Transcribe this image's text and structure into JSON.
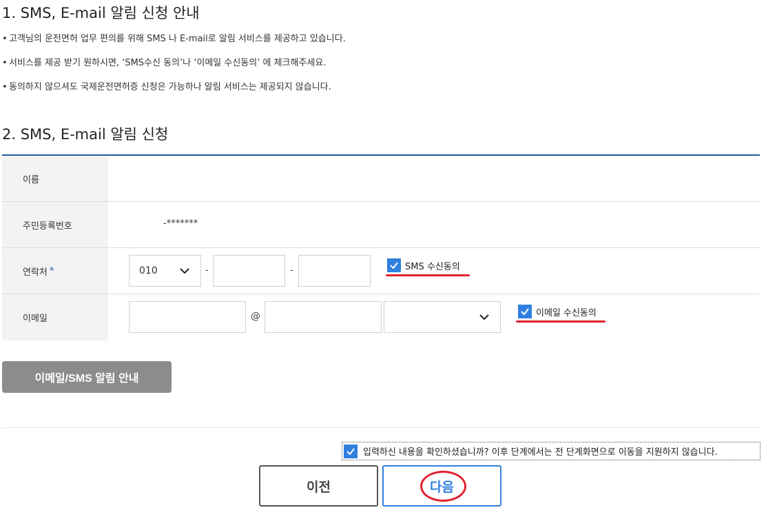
{
  "section1": {
    "title": "1. SMS, E-mail 알림 신청 안내",
    "bullets": [
      "고객님의 운전면허 업무 편의를 위해 SMS 나 E-mail로 알림 서비스를 제공하고 있습니다.",
      "서비스를 제공 받기 원하시면, ‘SMS수신 동의’나 ‘이메일 수신동의’ 에 체크해주세요.",
      "동의하지 않으셔도 국제운전면허증 신청은 가능하나 알림 서비스는 제공되지 않습니다."
    ],
    "bullet_mark": "•"
  },
  "section2": {
    "title": "2. SMS, E-mail 알림 신청"
  },
  "form": {
    "name_label": "이름",
    "name_value": "",
    "rrn_label": "주민등록번호",
    "rrn_value": "-*******",
    "phone_label": "연락처",
    "required_mark": "*",
    "phone_prefix": "010",
    "phone_dash": "-",
    "phone_mid": "",
    "phone_last": "",
    "sms_consent": "SMS 수신동의",
    "email_label": "이메일",
    "email_id": "",
    "email_at": "@",
    "email_domain": "",
    "email_domain_select": "",
    "email_consent": "이메일 수신동의"
  },
  "info_button": "이메일/SMS 알림 안내",
  "confirm_text": "입력하신 내용을 확인하셨습니까? 이후 단계에서는 전 단계화면으로 이동을 지원하지 않습니다.",
  "buttons": {
    "prev": "이전",
    "next": "다음"
  },
  "colors": {
    "accent": "#2f7fdf",
    "header_rule": "#1f5aa6",
    "annotation": "#e0232d",
    "info_button_bg": "#8c8c8c"
  },
  "icons": {
    "checkbox": "check-icon",
    "dropdown": "chevron-down-icon"
  }
}
